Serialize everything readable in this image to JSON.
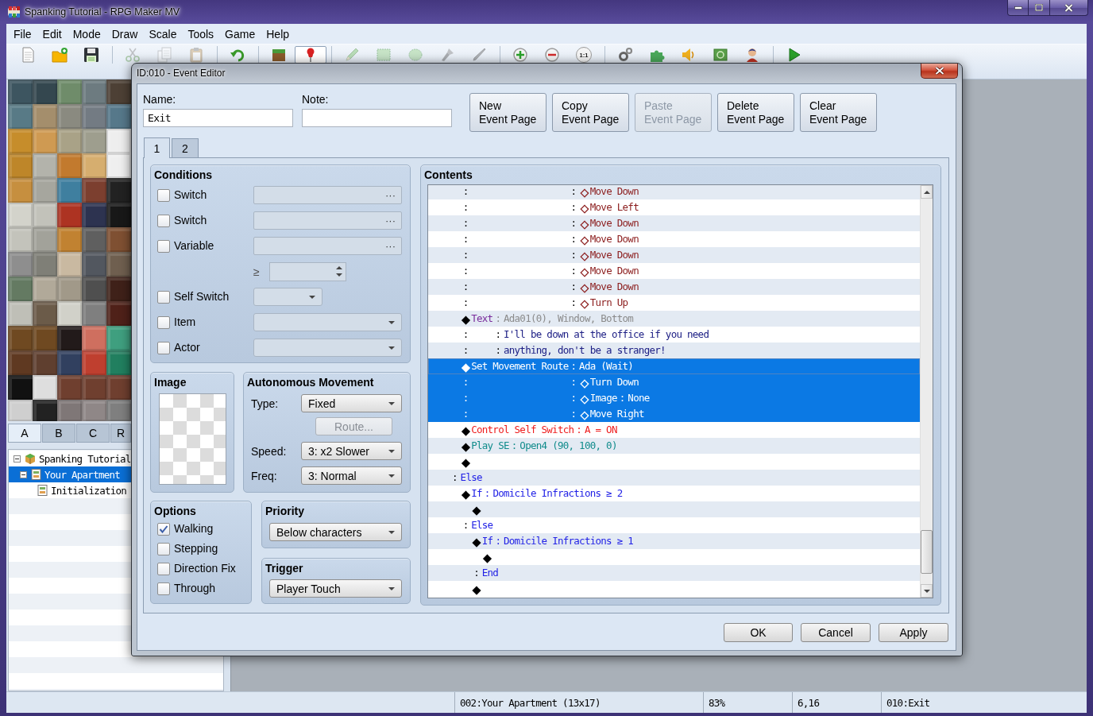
{
  "window": {
    "title": "Spanking Tutorial - RPG Maker MV"
  },
  "menu": [
    "File",
    "Edit",
    "Mode",
    "Draw",
    "Scale",
    "Tools",
    "Game",
    "Help"
  ],
  "toolbar": [
    {
      "kind": "new",
      "selected": false,
      "disabled": false
    },
    {
      "kind": "open",
      "selected": false,
      "disabled": false
    },
    {
      "kind": "save",
      "selected": false,
      "disabled": false
    },
    {
      "kind": "separator"
    },
    {
      "kind": "cut",
      "selected": false,
      "disabled": true
    },
    {
      "kind": "copy",
      "selected": false,
      "disabled": true
    },
    {
      "kind": "paste",
      "selected": false,
      "disabled": true
    },
    {
      "kind": "separator"
    },
    {
      "kind": "undo",
      "selected": false,
      "disabled": false
    },
    {
      "kind": "separator"
    },
    {
      "kind": "map_mode",
      "selected": false,
      "disabled": false
    },
    {
      "kind": "event_mode",
      "selected": true,
      "disabled": false
    },
    {
      "kind": "separator"
    },
    {
      "kind": "pencil",
      "selected": false,
      "disabled": true
    },
    {
      "kind": "rectangle",
      "selected": false,
      "disabled": true
    },
    {
      "kind": "ellipse",
      "selected": false,
      "disabled": true
    },
    {
      "kind": "fill",
      "selected": false,
      "disabled": true
    },
    {
      "kind": "shadow_pen",
      "selected": false,
      "disabled": true
    },
    {
      "kind": "separator"
    },
    {
      "kind": "zoom_in",
      "selected": false,
      "disabled": false
    },
    {
      "kind": "zoom_out",
      "selected": false,
      "disabled": false
    },
    {
      "kind": "zoom_actual",
      "label": "1:1",
      "selected": false,
      "disabled": false
    },
    {
      "kind": "separator"
    },
    {
      "kind": "database",
      "selected": false,
      "disabled": false
    },
    {
      "kind": "plugins",
      "selected": false,
      "disabled": false
    },
    {
      "kind": "sound",
      "selected": false,
      "disabled": false
    },
    {
      "kind": "resources",
      "selected": false,
      "disabled": false
    },
    {
      "kind": "generator",
      "selected": false,
      "disabled": false
    },
    {
      "kind": "separator"
    },
    {
      "kind": "playtest",
      "selected": false,
      "disabled": false
    }
  ],
  "tileset": {
    "tabs": [
      {
        "label": "A",
        "selected": true
      },
      {
        "label": "B",
        "selected": false
      },
      {
        "label": "C",
        "selected": false
      },
      {
        "label": "R",
        "selected": false
      }
    ]
  },
  "map_tree": {
    "items": [
      {
        "kind": "project",
        "label": "Spanking Tutorial",
        "expanded": true,
        "selected": false,
        "children": [
          {
            "kind": "map",
            "label": "Your Apartment",
            "expanded": true,
            "selected": true,
            "children": [
              {
                "kind": "map",
                "label": "Initialization",
                "selected": false
              }
            ]
          }
        ]
      }
    ]
  },
  "event_editor": {
    "title": "ID:010 - Event Editor",
    "name": {
      "label": "Name:",
      "value": "Exit"
    },
    "note": {
      "label": "Note:"
    },
    "page_buttons": [
      {
        "label": "New\nEvent Page",
        "disabled": false
      },
      {
        "label": "Copy\nEvent Page",
        "disabled": false
      },
      {
        "label": "Paste\nEvent Page",
        "disabled": true
      },
      {
        "label": "Delete\nEvent Page",
        "disabled": false
      },
      {
        "label": "Clear\nEvent Page",
        "disabled": false
      }
    ],
    "tabs": [
      {
        "label": "1",
        "selected": true
      },
      {
        "label": "2",
        "selected": false
      }
    ],
    "conditions": {
      "title": "Conditions",
      "rows": [
        {
          "kind": "picker",
          "label": "Switch",
          "checked": false,
          "button": "···"
        },
        {
          "kind": "picker",
          "label": "Switch",
          "checked": false,
          "button": "···"
        },
        {
          "kind": "picker",
          "label": "Variable",
          "checked": false,
          "button": "···"
        },
        {
          "kind": "number",
          "sign": "≥",
          "disabled": true
        },
        {
          "kind": "short_select",
          "label": "Self Switch",
          "checked": false
        },
        {
          "kind": "select",
          "label": "Item",
          "checked": false
        },
        {
          "kind": "select",
          "label": "Actor",
          "checked": false
        }
      ]
    },
    "image": {
      "title": "Image"
    },
    "autonomous_movement": {
      "title": "Autonomous Movement",
      "type": {
        "label": "Type:",
        "value": "Fixed"
      },
      "route": {
        "label": "Route...",
        "disabled": true
      },
      "speed": {
        "label": "Speed:",
        "value": "3: x2 Slower"
      },
      "freq": {
        "label": "Freq:",
        "value": "3: Normal"
      }
    },
    "options": {
      "title": "Options",
      "items": [
        {
          "label": "Walking",
          "checked": true
        },
        {
          "label": "Stepping",
          "checked": false
        },
        {
          "label": "Direction Fix",
          "checked": false
        },
        {
          "label": "Through",
          "checked": false
        }
      ]
    },
    "priority": {
      "title": "Priority",
      "value": "Below characters"
    },
    "trigger": {
      "title": "Trigger",
      "value": "Player Touch"
    },
    "contents": {
      "title": "Contents",
      "commands": [
        {
          "kind": "if",
          "children": [
            {
              "kind": "route",
              "lines": [
                {
                  "mark": ":",
                  "sep": ":",
                  "bullet": "◇",
                  "text": "Move Down",
                  "selected": false
                },
                {
                  "mark": ":",
                  "sep": ":",
                  "bullet": "◇",
                  "text": "Move Left",
                  "selected": false
                },
                {
                  "mark": ":",
                  "sep": ":",
                  "bullet": "◇",
                  "text": "Move Down",
                  "selected": false
                },
                {
                  "mark": ":",
                  "sep": ":",
                  "bullet": "◇",
                  "text": "Move Down",
                  "selected": false
                },
                {
                  "mark": ":",
                  "sep": ":",
                  "bullet": "◇",
                  "text": "Move Down",
                  "selected": false
                },
                {
                  "mark": ":",
                  "sep": ":",
                  "bullet": "◇",
                  "text": "Move Down",
                  "selected": false
                },
                {
                  "mark": ":",
                  "sep": ":",
                  "bullet": "◇",
                  "text": "Move Down",
                  "selected": false
                },
                {
                  "mark": ":",
                  "sep": ":",
                  "bullet": "◇",
                  "text": "Turn Up",
                  "selected": false
                }
              ]
            },
            {
              "kind": "text",
              "mark": "◆",
              "name": "Text",
              "sep": ":",
              "params": "Ada01(0), Window, Bottom",
              "selected": false,
              "lines": [
                {
                  "mark": ":",
                  "sep": ":",
                  "text": "I'll be down at the office if you need",
                  "selected": false
                },
                {
                  "mark": ":",
                  "sep": ":",
                  "text": "anything, don't be a stranger!",
                  "selected": false
                }
              ]
            },
            {
              "kind": "route",
              "mark": "◆",
              "name": "Set Movement Route",
              "sep": ":",
              "params": "Ada (Wait)",
              "selected": true,
              "lines": [
                {
                  "mark": ":",
                  "sep": ":",
                  "bullet": "◇",
                  "text": "Turn Down",
                  "selected": true
                },
                {
                  "mark": ":",
                  "sep": ":",
                  "bullet": "◇",
                  "text": "Image",
                  "sep2": ":",
                  "params": "None",
                  "selected": true
                },
                {
                  "mark": ":",
                  "sep": ":",
                  "bullet": "◇",
                  "text": "Move Right",
                  "selected": true
                }
              ]
            },
            {
              "kind": "switch",
              "mark": "◆",
              "name": "Control Self Switch",
              "sep": ":",
              "params": "A = ON",
              "selected": false
            },
            {
              "kind": "sound",
              "mark": "◆",
              "name": "Play SE",
              "sep": ":",
              "params": "Open4 (90, 100, 0)",
              "selected": false
            },
            {
              "kind": "empty",
              "mark": "◆",
              "selected": false
            }
          ]
        },
        {
          "kind": "else",
          "mark": ":",
          "name": "Else",
          "selected": false,
          "children": [
            {
              "kind": "if",
              "mark": "◆",
              "name": "If",
              "sep": ":",
              "params": "Domicile Infractions ≥ 2",
              "selected": false,
              "children": [
                {
                  "kind": "empty",
                  "mark": "◆",
                  "selected": false
                }
              ]
            },
            {
              "kind": "else",
              "mark": ":",
              "name": "Else",
              "selected": false,
              "children": [
                {
                  "kind": "if",
                  "mark": "◆",
                  "name": "If",
                  "sep": ":",
                  "params": "Domicile Infractions ≥ 1",
                  "selected": false,
                  "children": [
                    {
                      "kind": "empty",
                      "mark": "◆",
                      "selected": false
                    }
                  ]
                },
                {
                  "kind": "end",
                  "mark": ":",
                  "name": "End",
                  "selected": false
                },
                {
                  "kind": "empty",
                  "mark": "◆",
                  "selected": false
                }
              ]
            }
          ]
        }
      ]
    },
    "buttons": [
      {
        "label": "OK"
      },
      {
        "label": "Cancel"
      },
      {
        "label": "Apply"
      }
    ]
  },
  "status_bar": {
    "sections": [
      "002:Your Apartment (13x17)",
      "83%",
      "6,16",
      "010:Exit"
    ]
  }
}
